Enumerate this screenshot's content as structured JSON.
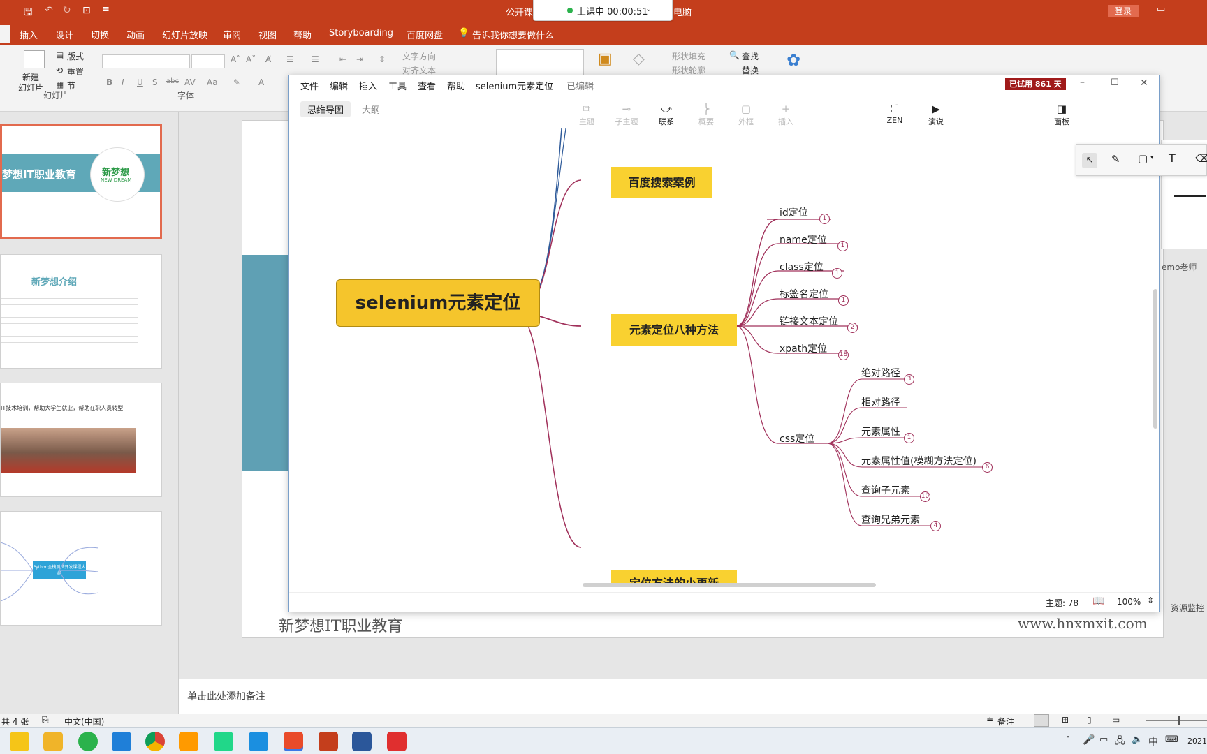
{
  "ppt": {
    "title": "公开课",
    "title_right": "电脑",
    "login_label": "登录",
    "tabs": [
      "插入",
      "设计",
      "切换",
      "动画",
      "幻灯片放映",
      "审阅",
      "视图",
      "帮助",
      "Storyboarding",
      "百度网盘"
    ],
    "tell_me": "告诉我你想要做什么",
    "ribbon": {
      "new_slide": "新建\n幻灯片",
      "layout": "版式",
      "reset": "重置",
      "section": "节",
      "group_slides": "幻灯片",
      "group_font": "字体",
      "text_direction": "文字方向",
      "align_text": "对齐文本",
      "shape_fill": "形状填充",
      "shape_outline": "形状轮廓",
      "find": "查找",
      "replace": "替换"
    },
    "thumbnails": {
      "t1_title": "梦想IT职业教育",
      "t1_logo": "新梦想",
      "t1_logo_sub": "NEW DREAM",
      "t2_title": "新梦想介绍",
      "t3_text": "IT技术培训，帮助大学生就业，帮助在职人员转型",
      "t4_center": "Python全栈测试开发课程大纲"
    },
    "slide": {
      "footer_left": "新梦想IT职业教育",
      "footer_right": "www.hnxmxit.com",
      "right_text": "emo老师",
      "right_text2": "资源监控"
    },
    "notes_placeholder": "单击此处添加备注",
    "status": {
      "slide_count": "共 4 张",
      "language": "中文(中国)",
      "notes": "备注"
    },
    "taskbar": {
      "ime": "中",
      "date": "2021"
    }
  },
  "recording": {
    "label": "上课中 00:00:51"
  },
  "xmind": {
    "menu": [
      "文件",
      "编辑",
      "插入",
      "工具",
      "查看",
      "帮助"
    ],
    "doc_title": "selenium元素定位",
    "doc_state": "— 已编辑",
    "trial_badge": "已试用 861 天",
    "view_tabs": [
      "思维导图",
      "大纲"
    ],
    "tools": [
      {
        "label": "主题",
        "icon": "topic-icon"
      },
      {
        "label": "子主题",
        "icon": "subtopic-icon"
      },
      {
        "label": "联系",
        "icon": "relationship-icon"
      },
      {
        "label": "概要",
        "icon": "summary-icon"
      },
      {
        "label": "外框",
        "icon": "boundary-icon"
      },
      {
        "label": "插入",
        "icon": "insert-icon"
      }
    ],
    "zen_label": "ZEN",
    "present_label": "演说",
    "panel_label": "面板",
    "central": "selenium元素定位",
    "topics": [
      "百度搜索案例",
      "元素定位八种方法",
      "定位方法的小更新"
    ],
    "methods": [
      {
        "label": "id定位",
        "count": "1"
      },
      {
        "label": "name定位",
        "count": "1"
      },
      {
        "label": "class定位",
        "count": "1"
      },
      {
        "label": "标签名定位",
        "count": "1"
      },
      {
        "label": "链接文本定位",
        "count": "2"
      },
      {
        "label": "xpath定位",
        "count": "18"
      }
    ],
    "css_label": "css定位",
    "css_children": [
      {
        "label": "绝对路径",
        "count": "3"
      },
      {
        "label": "相对路径",
        "count": ""
      },
      {
        "label": "元素属性",
        "count": "1"
      },
      {
        "label": "元素属性值(模糊方法定位)",
        "count": "6"
      },
      {
        "label": "查询子元素",
        "count": "10"
      },
      {
        "label": "查询兄弟元素",
        "count": "4"
      }
    ],
    "status_topics": "主题: 78",
    "zoom": "100%"
  },
  "colors": {
    "ppt_red": "#c43e1c",
    "branch_line": "#a0305a",
    "blue_line": "#2f5b9a",
    "topic_yellow": "#f9d130"
  }
}
